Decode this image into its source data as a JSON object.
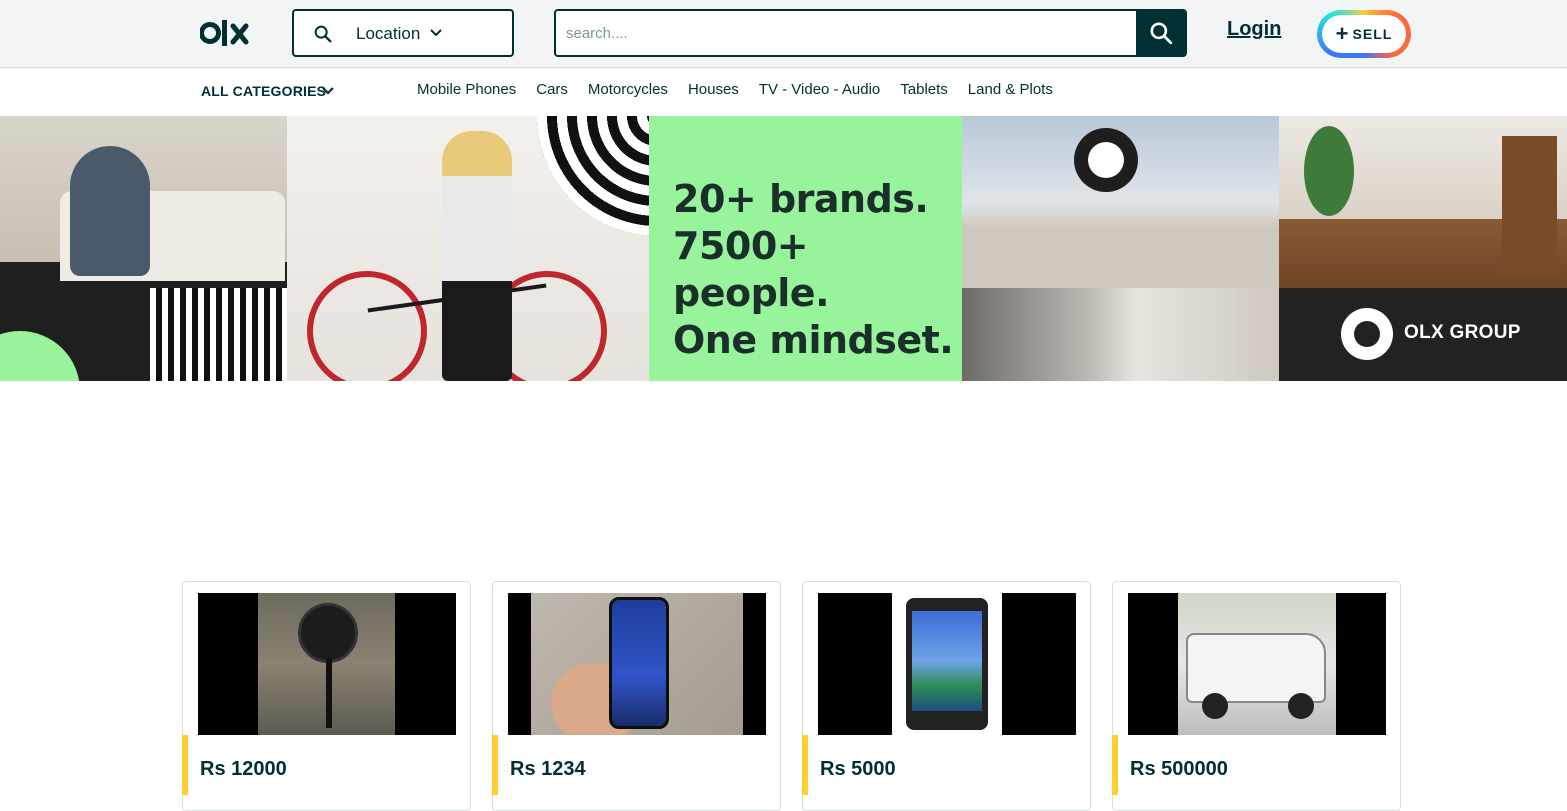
{
  "header": {
    "logo_text": "olx",
    "location_label": "Location",
    "search_placeholder": "search....",
    "login_label": "Login",
    "sell_label": "SELL"
  },
  "categories": {
    "all_label": "ALL CATEGORIES",
    "links": [
      "Mobile Phones",
      "Cars",
      "Motorcycles",
      "Houses",
      "TV - Video - Audio",
      "Tablets",
      "Land & Plots"
    ]
  },
  "banner": {
    "slogan_line1": "20+ brands.",
    "slogan_line2": "7500+ people.",
    "slogan_line3": "One mindset.",
    "group_text": "OLX GROUP"
  },
  "listings": [
    {
      "price": "Rs 12000",
      "image": "pedestal-fan"
    },
    {
      "price": "Rs 1234",
      "image": "smartphone-in-hand"
    },
    {
      "price": "Rs 5000",
      "image": "tablet"
    },
    {
      "price": "Rs 500000",
      "image": "white-hatchback-car"
    }
  ],
  "colors": {
    "brand": "#002f34",
    "header_bg": "#f2f4f5",
    "banner_green": "#98f49b",
    "price_accent": "#ffce32"
  }
}
